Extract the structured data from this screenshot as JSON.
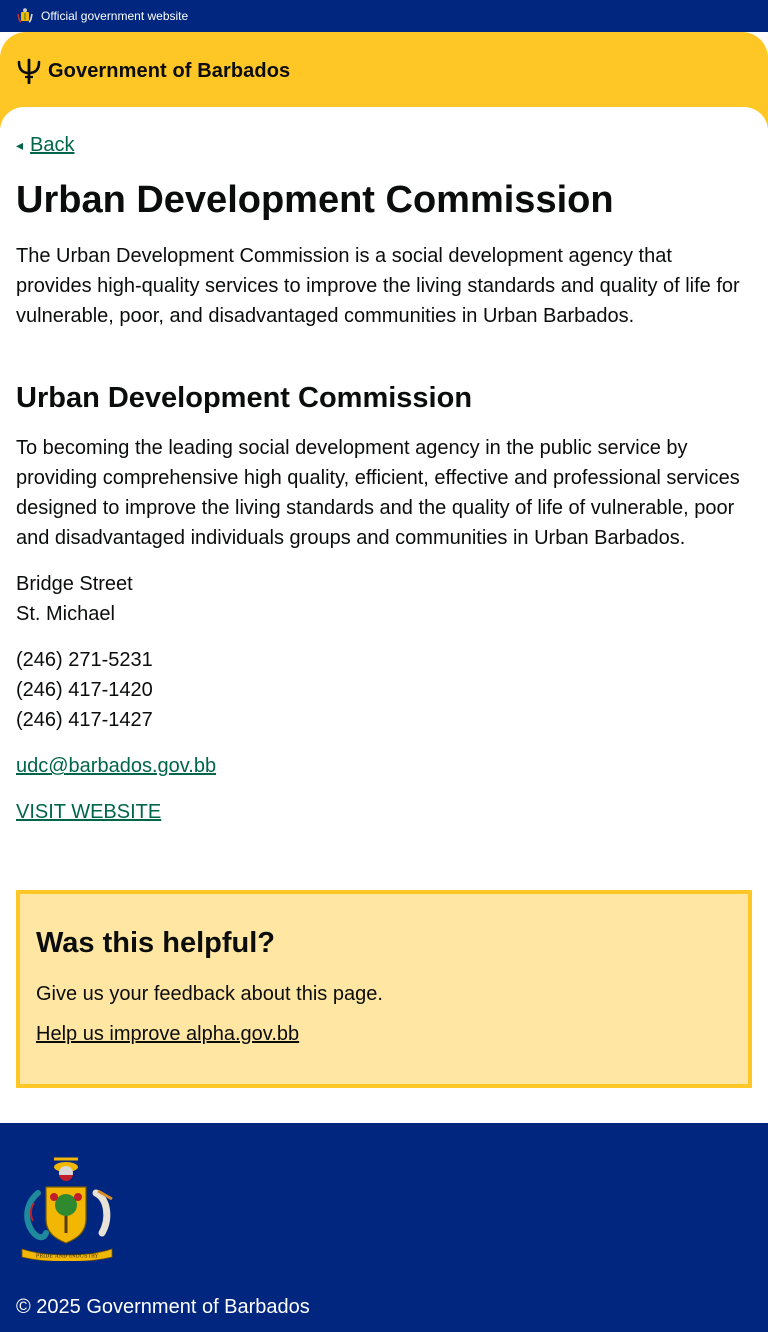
{
  "official_bar": {
    "text": "Official government website"
  },
  "header": {
    "brand": "Government of Barbados"
  },
  "back": {
    "label": "Back"
  },
  "page": {
    "title": "Urban Development Commission",
    "lead": "The Urban Development Commission is a social development agency that provides high-quality services to improve the living standards and quality of life for vulnerable, poor, and disadvantaged communities in Urban Barbados.",
    "section_title": "Urban Development Commission",
    "mission": "To becoming the leading social development agency in the public service by providing comprehensive high quality, efficient, effective and professional services designed to improve the living standards and the quality of life of vulnerable, poor and disadvantaged individuals groups and communities in Urban Barbados.",
    "address": [
      "Bridge Street",
      "St. Michael"
    ],
    "phones": [
      "(246) 271-5231",
      "(246) 417-1420",
      "(246) 417-1427"
    ],
    "email": "udc@barbados.gov.bb",
    "website_label": "VISIT WEBSITE"
  },
  "feedback": {
    "title": "Was this helpful?",
    "text": "Give us your feedback about this page.",
    "link": "Help us improve alpha.gov.bb"
  },
  "footer": {
    "copyright": "© 2025 Government of Barbados",
    "coat_motto": "PRIDE AND INDUSTRY"
  },
  "colors": {
    "navy": "#00267f",
    "gold": "#ffc726",
    "feedback_bg": "#ffe7a3",
    "link_green": "#00654a"
  }
}
